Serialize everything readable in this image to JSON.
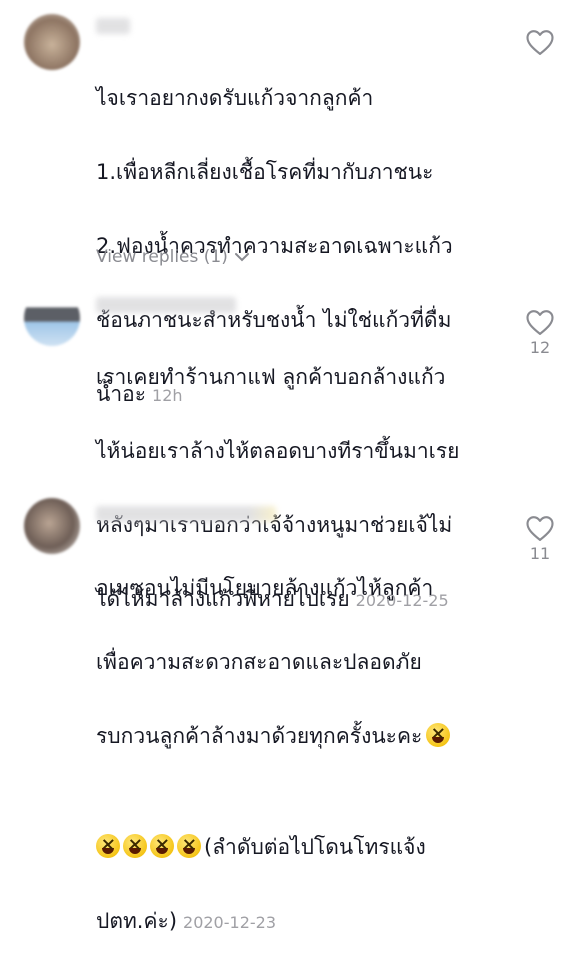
{
  "comments": [
    {
      "lines": [
        "ไจเราอยากงดรับแก้วจากลูกค้า",
        "1.เพื่อหลีกเลี่ยงเชื้อโรคที่มากับภาชนะ",
        "2.ฟองน้ำควรทำความสะอาดเฉพาะแก้ว",
        "ช้อนภาชนะสำหรับชงน้ำ ไม่ใช่แก้วที่ดื่ม",
        "น้ำอะ"
      ],
      "time": "12h",
      "likes": ""
    },
    {
      "lines": [
        "เราเคยทำร้านกาแฟ ลูกค้าบอกล้างแก้ว",
        "ไห้น่อยเราล้างไห้ตลอดบางทีราขึ้นมาเรย",
        "หลังๆมาเราบอกว่าเจ้จ้างหนูมาช่วยเจ้ไม่",
        "ได้ไห้มาล้างแก้วพี่หายไปเรย"
      ],
      "time": "2020-12-25",
      "likes": "12"
    },
    {
      "lines": [
        "อเมซอนไม่มีนโยบายล้างแก้วไห้ลูกค้า",
        "เพื่อความสะดวกสะอาดและปลอดภัย",
        "รบกวนลูกค้าล้างมาด้วยทุกครั้งนะคะ",
        "(ลำดับต่อไปโดนโทรแจ้ง",
        "ปตท.ค่ะ)"
      ],
      "time": "2020-12-23",
      "likes": "11"
    }
  ],
  "view_replies": "View replies (1)",
  "colors": {
    "text": "#161823",
    "meta": "#a0a0a5",
    "icon": "#8a8b91"
  },
  "icons": {
    "like": "heart-outline-icon",
    "expand": "chevron-down-icon",
    "emoji": "grinning-squinting-face"
  }
}
